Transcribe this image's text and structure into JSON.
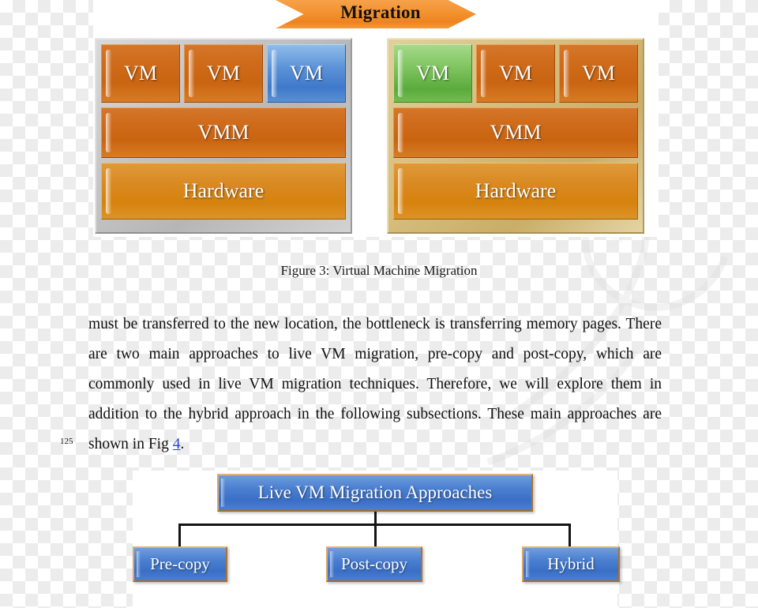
{
  "figure3": {
    "banner_label": "Migration",
    "hosts": [
      {
        "id": "source-host",
        "frame": "silver",
        "vms": [
          {
            "label": "VM",
            "state": "normal",
            "color": "#cf6c1b"
          },
          {
            "label": "VM",
            "state": "normal",
            "color": "#cf6c1b"
          },
          {
            "label": "VM",
            "state": "migrating",
            "color": "#4a7fd0"
          }
        ],
        "vmm_label": "VMM",
        "hardware_label": "Hardware"
      },
      {
        "id": "destination-host",
        "frame": "gold",
        "vms": [
          {
            "label": "VM",
            "state": "migrated",
            "color": "#7fc45f"
          },
          {
            "label": "VM",
            "state": "normal",
            "color": "#cf6c1b"
          },
          {
            "label": "VM",
            "state": "normal",
            "color": "#cf6c1b"
          }
        ],
        "vmm_label": "VMM",
        "hardware_label": "Hardware"
      }
    ],
    "caption": "Figure 3: Virtual Machine Migration"
  },
  "body": {
    "line_number": "125",
    "paragraph_part1": "must be transferred to the new location, the bottleneck is transferring memory pages. There are two main approaches to live VM migration, pre-copy and post-copy, which are commonly used in live VM migration techniques. Therefore, we will explore them in addition to the hybrid approach in the following subsections. These main approaches are shown in Fig ",
    "figure_reference": "4",
    "paragraph_part2": "."
  },
  "figure4": {
    "root_label": "Live VM Migration Approaches",
    "children": [
      {
        "label": "Pre-copy"
      },
      {
        "label": "Post-copy"
      },
      {
        "label": "Hybrid"
      }
    ]
  },
  "colors": {
    "orange": "#cf6c1b",
    "orange_light": "#d98a22",
    "blue": "#4a7fd0",
    "green": "#7fc45f",
    "banner_orange": "#f3902c",
    "silver_frame": "#c4c4c4",
    "gold_frame": "#d6bd7e",
    "link_blue": "#2a49c8",
    "flow_box_blue": "#4a7fd0",
    "flow_box_border": "#c98a3c"
  }
}
